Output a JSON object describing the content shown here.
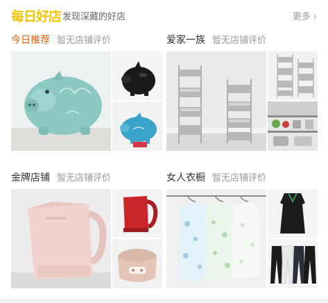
{
  "header": {
    "logo_text": "每日好店",
    "subtitle": "发现深藏的好店",
    "more_label": "更多",
    "chevron": "›"
  },
  "shops": [
    {
      "name": "今日推荐",
      "review": "暂无店铺评价"
    },
    {
      "name": "爱家一族",
      "review": "暂无店铺评价"
    },
    {
      "name": "金牌店铺",
      "review": "暂无店铺评价"
    },
    {
      "name": "女人衣橱",
      "review": "暂无店铺评价"
    }
  ],
  "colors": {
    "logo": "#f6c500",
    "highlight_shop_name": "#e4620f",
    "text": "#333333",
    "muted": "#999999"
  }
}
